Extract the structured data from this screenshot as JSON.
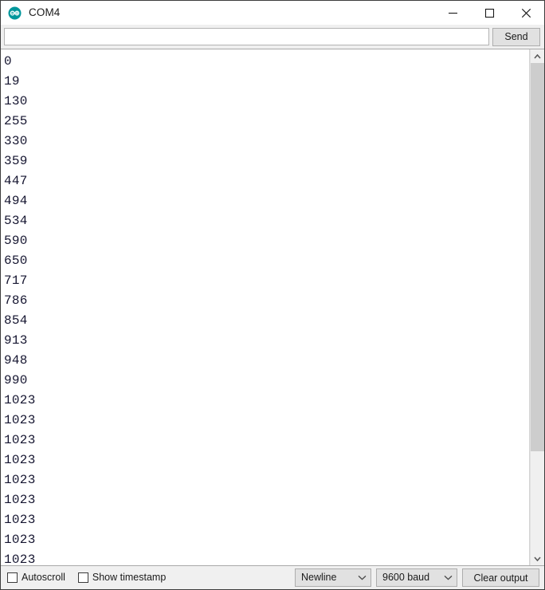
{
  "window": {
    "title": "COM4",
    "icon": "arduino-logo-icon",
    "controls": {
      "minimize": "minimize-icon",
      "maximize": "maximize-icon",
      "close": "close-icon"
    }
  },
  "send_row": {
    "input_value": "",
    "input_placeholder": "",
    "send_label": "Send"
  },
  "output": {
    "lines": [
      "0",
      "19",
      "130",
      "255",
      "330",
      "359",
      "447",
      "494",
      "534",
      "590",
      "650",
      "717",
      "786",
      "854",
      "913",
      "948",
      "990",
      "1023",
      "1023",
      "1023",
      "1023",
      "1023",
      "1023",
      "1023",
      "1023",
      "1023"
    ],
    "text_color": "#151530",
    "background_color": "#ffffff"
  },
  "scrollbar": {
    "up_arrow": "chevron-up-icon",
    "down_arrow": "chevron-down-icon",
    "thumb_fraction": 0.795
  },
  "bottom_bar": {
    "autoscroll": {
      "label": "Autoscroll",
      "checked": false
    },
    "show_timestamp": {
      "label": "Show timestamp",
      "checked": false
    },
    "line_ending": {
      "selected": "Newline"
    },
    "baud_rate": {
      "selected": "9600 baud"
    },
    "clear_label": "Clear output"
  },
  "colors": {
    "arduino_teal": "#00979c",
    "toolbar_bg": "#f0f0f0",
    "button_bg": "#e1e1e1",
    "window_border": "#3d3d3d"
  }
}
